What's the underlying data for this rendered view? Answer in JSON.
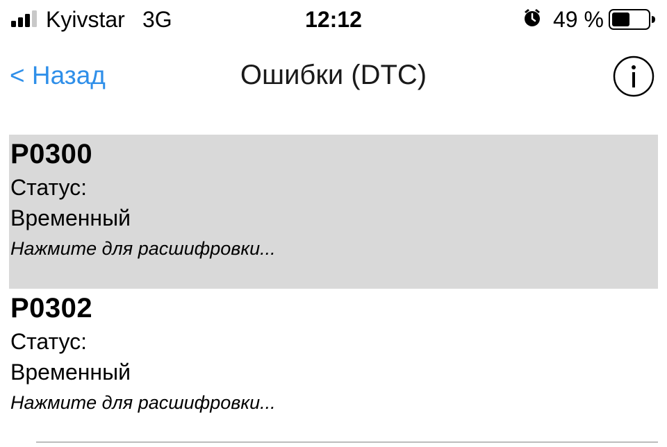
{
  "status_bar": {
    "carrier": "Kyivstar",
    "network": "3G",
    "time": "12:12",
    "battery_percent": "49 %",
    "battery_level": 0.49,
    "signal_icon": "signal-bars-icon",
    "alarm_icon": "alarm-clock-icon",
    "battery_icon": "battery-icon"
  },
  "nav": {
    "back_label": "< Назад",
    "title": "Ошибки (DTC)",
    "info_icon": "info-icon"
  },
  "dtc_items": [
    {
      "code": "P0300",
      "status_label": "Статус:",
      "status_value": "Временный",
      "hint": "Нажмите для расшифровки...",
      "selected": true
    },
    {
      "code": "P0302",
      "status_label": "Статус:",
      "status_value": "Временный",
      "hint": "Нажмите для расшифровки...",
      "selected": false
    }
  ],
  "colors": {
    "accent": "#2f8fe9",
    "selected_row": "#d9d9d9",
    "divider": "#bcbcbc"
  }
}
